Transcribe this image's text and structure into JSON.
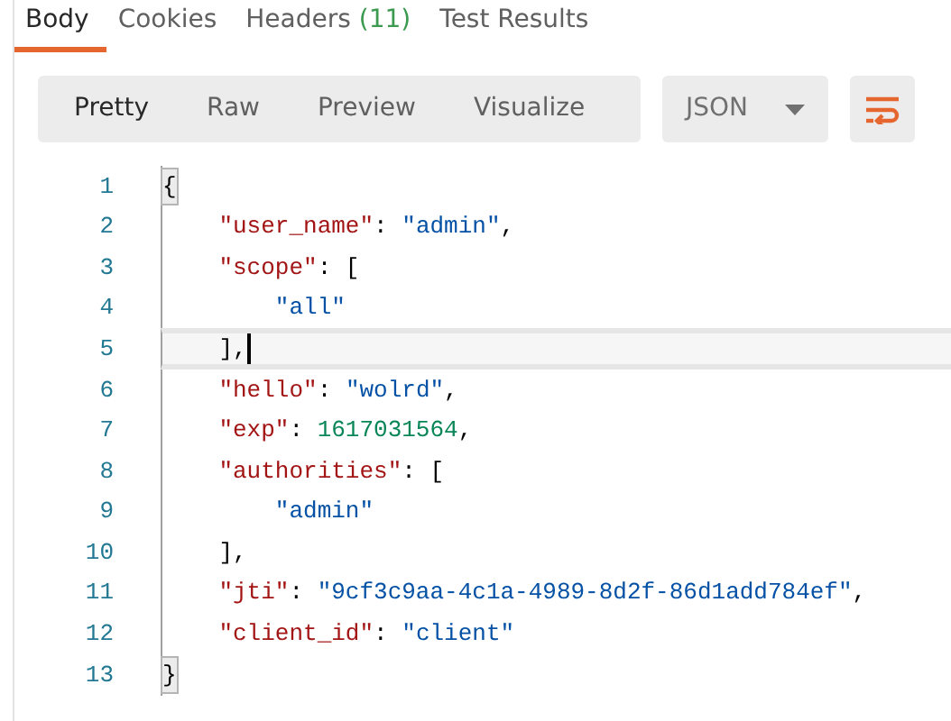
{
  "tabs": [
    {
      "label": "Body",
      "selected": true
    },
    {
      "label": "Cookies",
      "selected": false
    },
    {
      "label": "Headers",
      "count": "(11)",
      "selected": false
    },
    {
      "label": "Test Results",
      "selected": false
    }
  ],
  "views": [
    {
      "label": "Pretty",
      "selected": true
    },
    {
      "label": "Raw",
      "selected": false
    },
    {
      "label": "Preview",
      "selected": false
    },
    {
      "label": "Visualize",
      "selected": false
    }
  ],
  "format": {
    "value": "JSON"
  },
  "wrap_button": {
    "on": true
  },
  "code": {
    "lines": [
      {
        "number": "1",
        "current": false,
        "matched": true,
        "tokens": [
          {
            "kind": "punct",
            "text": "{"
          }
        ]
      },
      {
        "number": "2",
        "current": false,
        "tokens": [
          {
            "kind": "key",
            "text": "    \"user_name\""
          },
          {
            "kind": "punct",
            "text": ": "
          },
          {
            "kind": "string",
            "text": "\"admin\""
          },
          {
            "kind": "punct",
            "text": ","
          }
        ]
      },
      {
        "number": "3",
        "current": false,
        "tokens": [
          {
            "kind": "key",
            "text": "    \"scope\""
          },
          {
            "kind": "punct",
            "text": ": ["
          }
        ]
      },
      {
        "number": "4",
        "current": false,
        "tokens": [
          {
            "kind": "string",
            "text": "        \"all\""
          }
        ]
      },
      {
        "number": "5",
        "current": true,
        "tokens": [
          {
            "kind": "punct",
            "text": "    ],"
          }
        ]
      },
      {
        "number": "6",
        "current": false,
        "tokens": [
          {
            "kind": "key",
            "text": "    \"hello\""
          },
          {
            "kind": "punct",
            "text": ": "
          },
          {
            "kind": "string",
            "text": "\"wolrd\""
          },
          {
            "kind": "punct",
            "text": ","
          }
        ]
      },
      {
        "number": "7",
        "current": false,
        "tokens": [
          {
            "kind": "key",
            "text": "    \"exp\""
          },
          {
            "kind": "punct",
            "text": ": "
          },
          {
            "kind": "number",
            "text": "1617031564"
          },
          {
            "kind": "punct",
            "text": ","
          }
        ]
      },
      {
        "number": "8",
        "current": false,
        "tokens": [
          {
            "kind": "key",
            "text": "    \"authorities\""
          },
          {
            "kind": "punct",
            "text": ": ["
          }
        ]
      },
      {
        "number": "9",
        "current": false,
        "tokens": [
          {
            "kind": "string",
            "text": "        \"admin\""
          }
        ]
      },
      {
        "number": "10",
        "current": false,
        "tokens": [
          {
            "kind": "punct",
            "text": "    ],"
          }
        ]
      },
      {
        "number": "11",
        "current": false,
        "tokens": [
          {
            "kind": "key",
            "text": "    \"jti\""
          },
          {
            "kind": "punct",
            "text": ": "
          },
          {
            "kind": "string",
            "text": "\"9cf3c9aa-4c1a-4989-8d2f-86d1add784ef\""
          },
          {
            "kind": "punct",
            "text": ","
          }
        ]
      },
      {
        "number": "12",
        "current": false,
        "tokens": [
          {
            "kind": "key",
            "text": "    \"client_id\""
          },
          {
            "kind": "punct",
            "text": ": "
          },
          {
            "kind": "string",
            "text": "\"client\""
          }
        ]
      },
      {
        "number": "13",
        "current": false,
        "matched": true,
        "tokens": [
          {
            "kind": "punct",
            "text": "}"
          }
        ]
      }
    ]
  }
}
